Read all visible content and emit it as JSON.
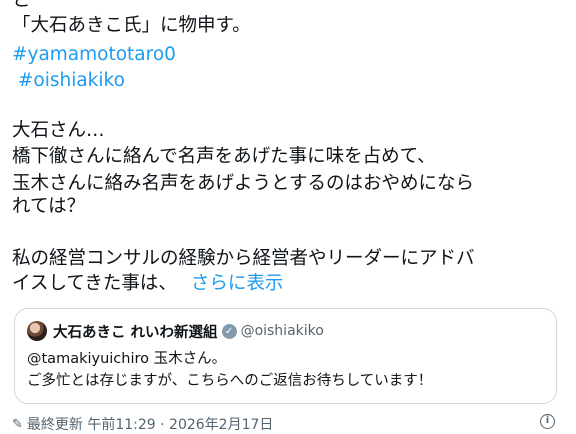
{
  "post": {
    "lines": [
      "と",
      "「大石あきこ氏」に物申す。",
      "#yamamototaro0",
      " #oishiakiko",
      "大石さん…",
      "橋下徹さんに絡んで名声をあげた事に味を占めて、",
      "玉木さんに絡み名声をあげようとするのはおやめになら",
      "れては？",
      "私の経営コンサルの経験から経営者やリーダーにアドバ",
      "イスしてきた事は、"
    ],
    "show_more": "さらに表示"
  },
  "quote": {
    "author_name": "大石あきこ れいわ新選組",
    "handle": "@oishiakiko",
    "verified_icon": "verified-badge",
    "line1": "@tamakiyuichiro 玉木さん。",
    "line2": "ご多忙とは存じますが、こちらへのご返信お待ちしています！"
  },
  "footer": {
    "edited_label": "最終更新 午前11:29 · 2026年2月17日",
    "icons": [
      "pencil-icon",
      "info-icon"
    ]
  },
  "colors": {
    "link": "#1d9bf0",
    "text": "#0f1419",
    "muted": "#536471",
    "border": "#cfd9de"
  }
}
